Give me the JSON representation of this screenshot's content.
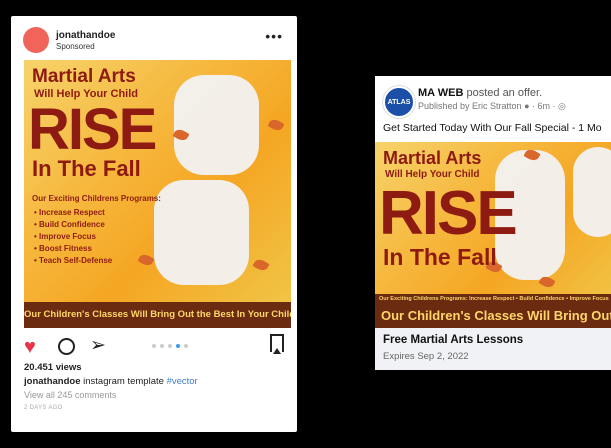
{
  "instagram": {
    "username": "jonathandoe",
    "sponsored": "Sponsored",
    "more": "•••",
    "views": "20.451 views",
    "caption_user": "jonathandoe",
    "caption_text": "instagram template",
    "caption_tag": "#vector",
    "comments": "View all 245 comments",
    "time_ago": "2 DAYS AGO",
    "carousel_total": 5,
    "carousel_active": 4
  },
  "ad": {
    "title_line1": "Martial Arts",
    "title_line2": "Will Help Your Child",
    "title_big": "RISE",
    "title_line3": "In The Fall",
    "programs_heading": "Our Exciting Childrens Programs:",
    "programs": [
      "Increase Respect",
      "Build Confidence",
      "Improve Focus",
      "Boost Fitness",
      "Teach Self-Defense"
    ],
    "banner": "Our Children's Classes Will Bring Out the Best In Your Child",
    "fb_strip": "Our Exciting Childrens Programs: Increase Respect • Build Confidence • Improve Focus",
    "fb_banner": "Our Children's Classes Will Bring Out the"
  },
  "facebook": {
    "avatar_text": "ATLAS",
    "page_name": "MA WEB",
    "action": "posted an offer.",
    "published": "Published by Eric Stratton",
    "time": "· 6m ·",
    "post_text": "Get Started Today With Our Fall Special - 1 Mo",
    "offer_title": "Free Martial Arts Lessons",
    "expires": "Expires Sep 2, 2022"
  },
  "colors": {
    "ad_red": "#8e1b12",
    "banner_bg": "#6b2b10",
    "banner_text": "#ffd66a",
    "heart": "#e8334a",
    "link": "#3d7fc9"
  }
}
